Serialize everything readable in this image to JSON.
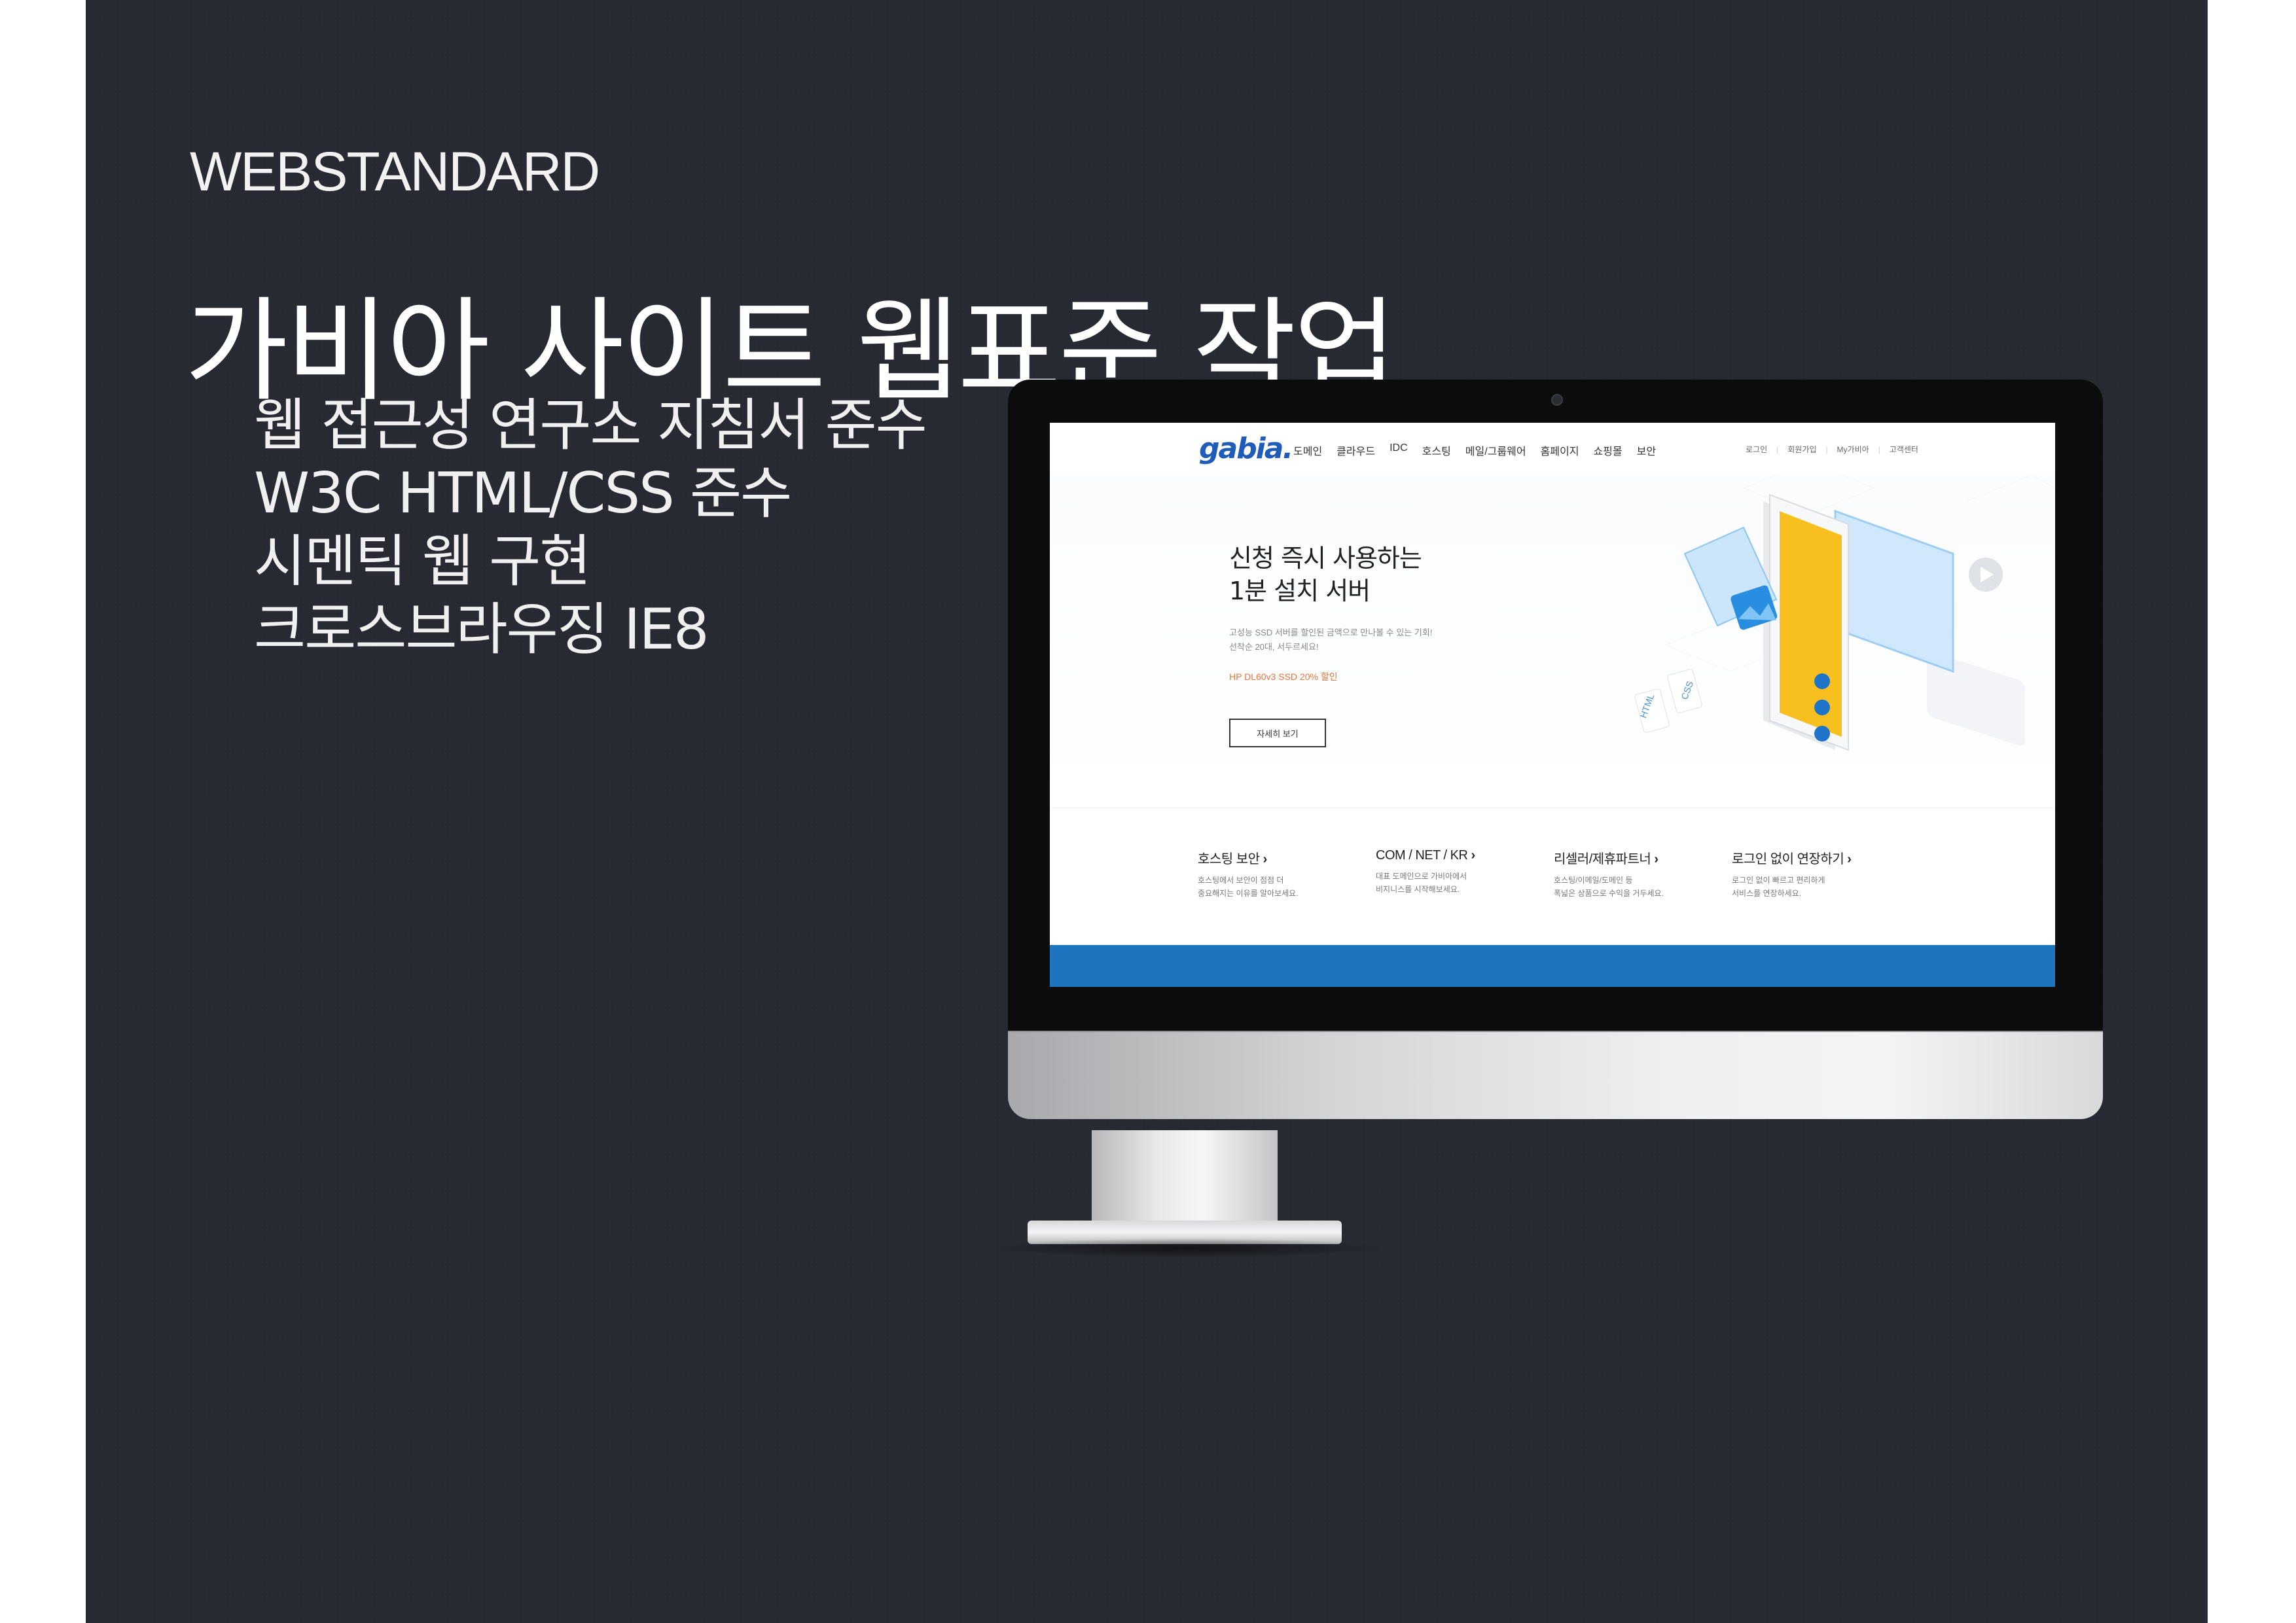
{
  "slide": {
    "eyebrow": "WEBSTANDARD",
    "headline": "가비아 사이트 웹표준 작업",
    "features": [
      "웹 접근성 연구소 지침서 준수",
      "W3C HTML/CSS 준수",
      "시멘틱 웹 구현",
      "크로스브라우징 IE8"
    ]
  },
  "site": {
    "logo": "gabia.",
    "nav": [
      "도메인",
      "클라우드",
      "IDC",
      "호스팅",
      "메일/그룹웨어",
      "홈페이지",
      "쇼핑몰",
      "보안"
    ],
    "util": [
      "로그인",
      "회원가입",
      "My가비아",
      "고객센터"
    ],
    "hero": {
      "title_line1": "신청 즉시 사용하는",
      "title_line2": "1분 설치 서버",
      "desc_line1": "고성능 SSD 서버를 할인된 금액으로 만나볼 수 있는 기회!",
      "desc_line2": "선착순 20대, 서두르세요!",
      "promo": "HP DL60v3 SSD 20% 할인",
      "button": "자세히 보기",
      "art_labels": [
        "HTML",
        "CSS"
      ]
    },
    "quick_links": [
      {
        "title": "호스팅 보안",
        "desc_line1": "호스팅에서 보안이 점점 더",
        "desc_line2": "중요해지는 이유를 알아보세요."
      },
      {
        "title": "COM / NET / KR",
        "desc_line1": "대표 도메인으로 가비아에서",
        "desc_line2": "비지니스를 시작해보세요."
      },
      {
        "title": "리셀러/제휴파트너",
        "desc_line1": "호스팅/이메일/도메인 등",
        "desc_line2": "폭넓은 상품으로 수익을 거두세요."
      },
      {
        "title": "로그인 없이 연장하기",
        "desc_line1": "로그인 없이 빠르고 편리하게",
        "desc_line2": "서비스를 연장하세요."
      }
    ]
  },
  "colors": {
    "background": "#272a32",
    "brand_blue": "#1f5bb8",
    "footer_blue": "#1e75bf",
    "promo_orange": "#e8743a"
  }
}
